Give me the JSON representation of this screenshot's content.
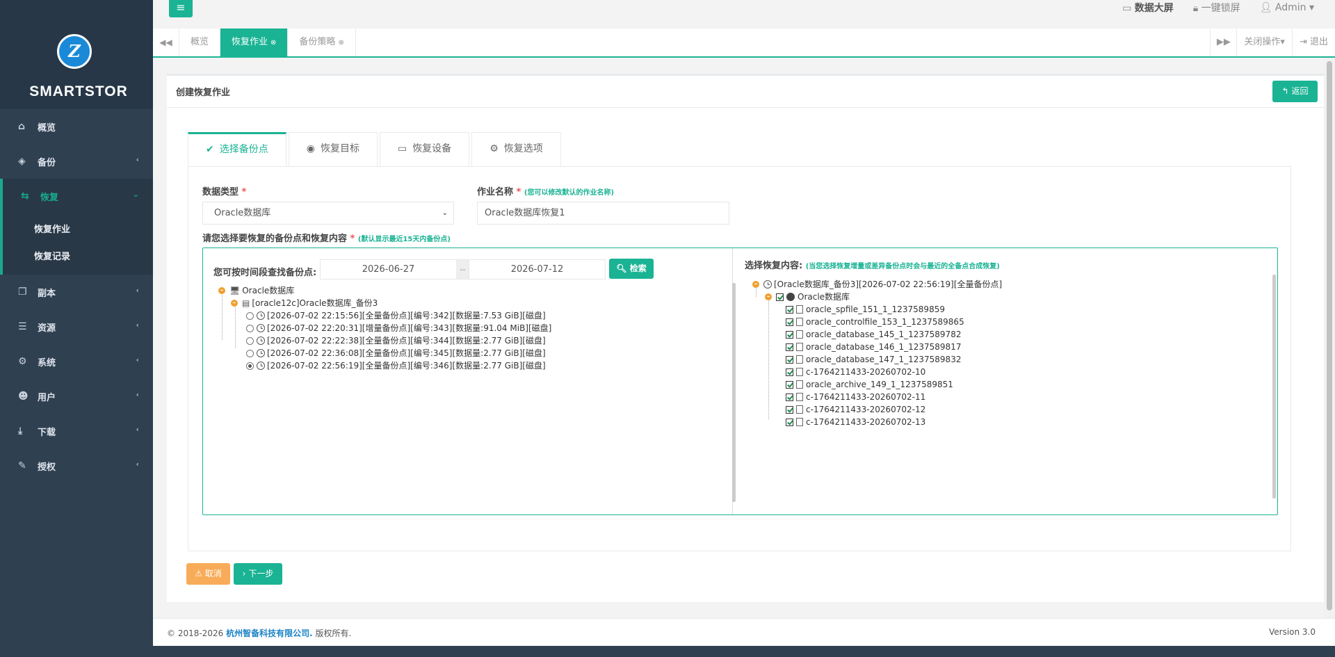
{
  "brand": {
    "name": "SMARTSTOR",
    "logo_text": "Z"
  },
  "sidebar": {
    "items": [
      {
        "label": "概览",
        "icon": "home-icon"
      },
      {
        "label": "备份",
        "icon": "cube-icon"
      },
      {
        "label": "恢复",
        "icon": "retweet-icon"
      },
      {
        "label": "副本",
        "icon": "copy-icon"
      },
      {
        "label": "资源",
        "icon": "server-icon"
      },
      {
        "label": "系统",
        "icon": "cogs-icon"
      },
      {
        "label": "用户",
        "icon": "users-icon"
      },
      {
        "label": "下载",
        "icon": "download-icon"
      },
      {
        "label": "授权",
        "icon": "edit-icon"
      }
    ],
    "sub_items": [
      "恢复作业",
      "恢复记录"
    ]
  },
  "topbar": {
    "dashboard": "数据大屏",
    "lock": "一键锁屏",
    "user": "Admin"
  },
  "tabs": [
    {
      "label": "概览"
    },
    {
      "label": "恢复作业"
    },
    {
      "label": "备份策略"
    }
  ],
  "tab_actions": {
    "close_ops": "关闭操作",
    "logout": "退出"
  },
  "panel": {
    "title": "创建恢复作业",
    "return": "返回"
  },
  "wizard_tabs": [
    "选择备份点",
    "恢复目标",
    "恢复设备",
    "恢复选项"
  ],
  "form": {
    "data_type_label": "数据类型",
    "data_type_value": "Oracle数据库",
    "job_name_label": "作业名称",
    "job_name_hint": "(您可以修改默认的作业名称)",
    "job_name_value": "Oracle数据库恢复1",
    "select_label": "请您选择要恢复的备份点和恢复内容",
    "select_hint": "(默认显示最近15天内备份点)",
    "required": "*"
  },
  "time_search": {
    "label": "您可按时间段查找备份点:",
    "start": "2026-06-27",
    "sep": "--",
    "end": "2026-07-12",
    "button": "检索"
  },
  "left_tree": {
    "root": "Oracle数据库",
    "child": "[oracle12c]Oracle数据库_备份3",
    "points": [
      {
        "text": "[2026-07-02 22:15:56][全量备份点][编号:342][数据量:7.53 GiB][磁盘]",
        "selected": false
      },
      {
        "text": "[2026-07-02 22:20:31][增量备份点][编号:343][数据量:91.04 MiB][磁盘]",
        "selected": false
      },
      {
        "text": "[2026-07-02 22:22:38][全量备份点][编号:344][数据量:2.77 GiB][磁盘]",
        "selected": false
      },
      {
        "text": "[2026-07-02 22:36:08][全量备份点][编号:345][数据量:2.77 GiB][磁盘]",
        "selected": false
      },
      {
        "text": "[2026-07-02 22:56:19][全量备份点][编号:346][数据量:2.77 GiB][磁盘]",
        "selected": true
      }
    ]
  },
  "right_tree": {
    "label": "选择恢复内容:",
    "hint": "(当您选择恢复增量或差异备份点时会与最近的全备点合成恢复)",
    "root": "[Oracle数据库_备份3][2026-07-02 22:56:19][全量备份点]",
    "child": "Oracle数据库",
    "files": [
      "oracle_spfile_151_1_1237589859",
      "oracle_controlfile_153_1_1237589865",
      "oracle_database_145_1_1237589782",
      "oracle_database_146_1_1237589817",
      "oracle_database_147_1_1237589832",
      "c-1764211433-20260702-10",
      "oracle_archive_149_1_1237589851",
      "c-1764211433-20260702-11",
      "c-1764211433-20260702-12",
      "c-1764211433-20260702-13"
    ]
  },
  "actions": {
    "cancel": "取消",
    "next": "下一步"
  },
  "footer": {
    "copyright": "© 2018-2026",
    "company": "杭州智备科技有限公司.",
    "rights": "版权所有.",
    "version": "Version 3.0"
  }
}
